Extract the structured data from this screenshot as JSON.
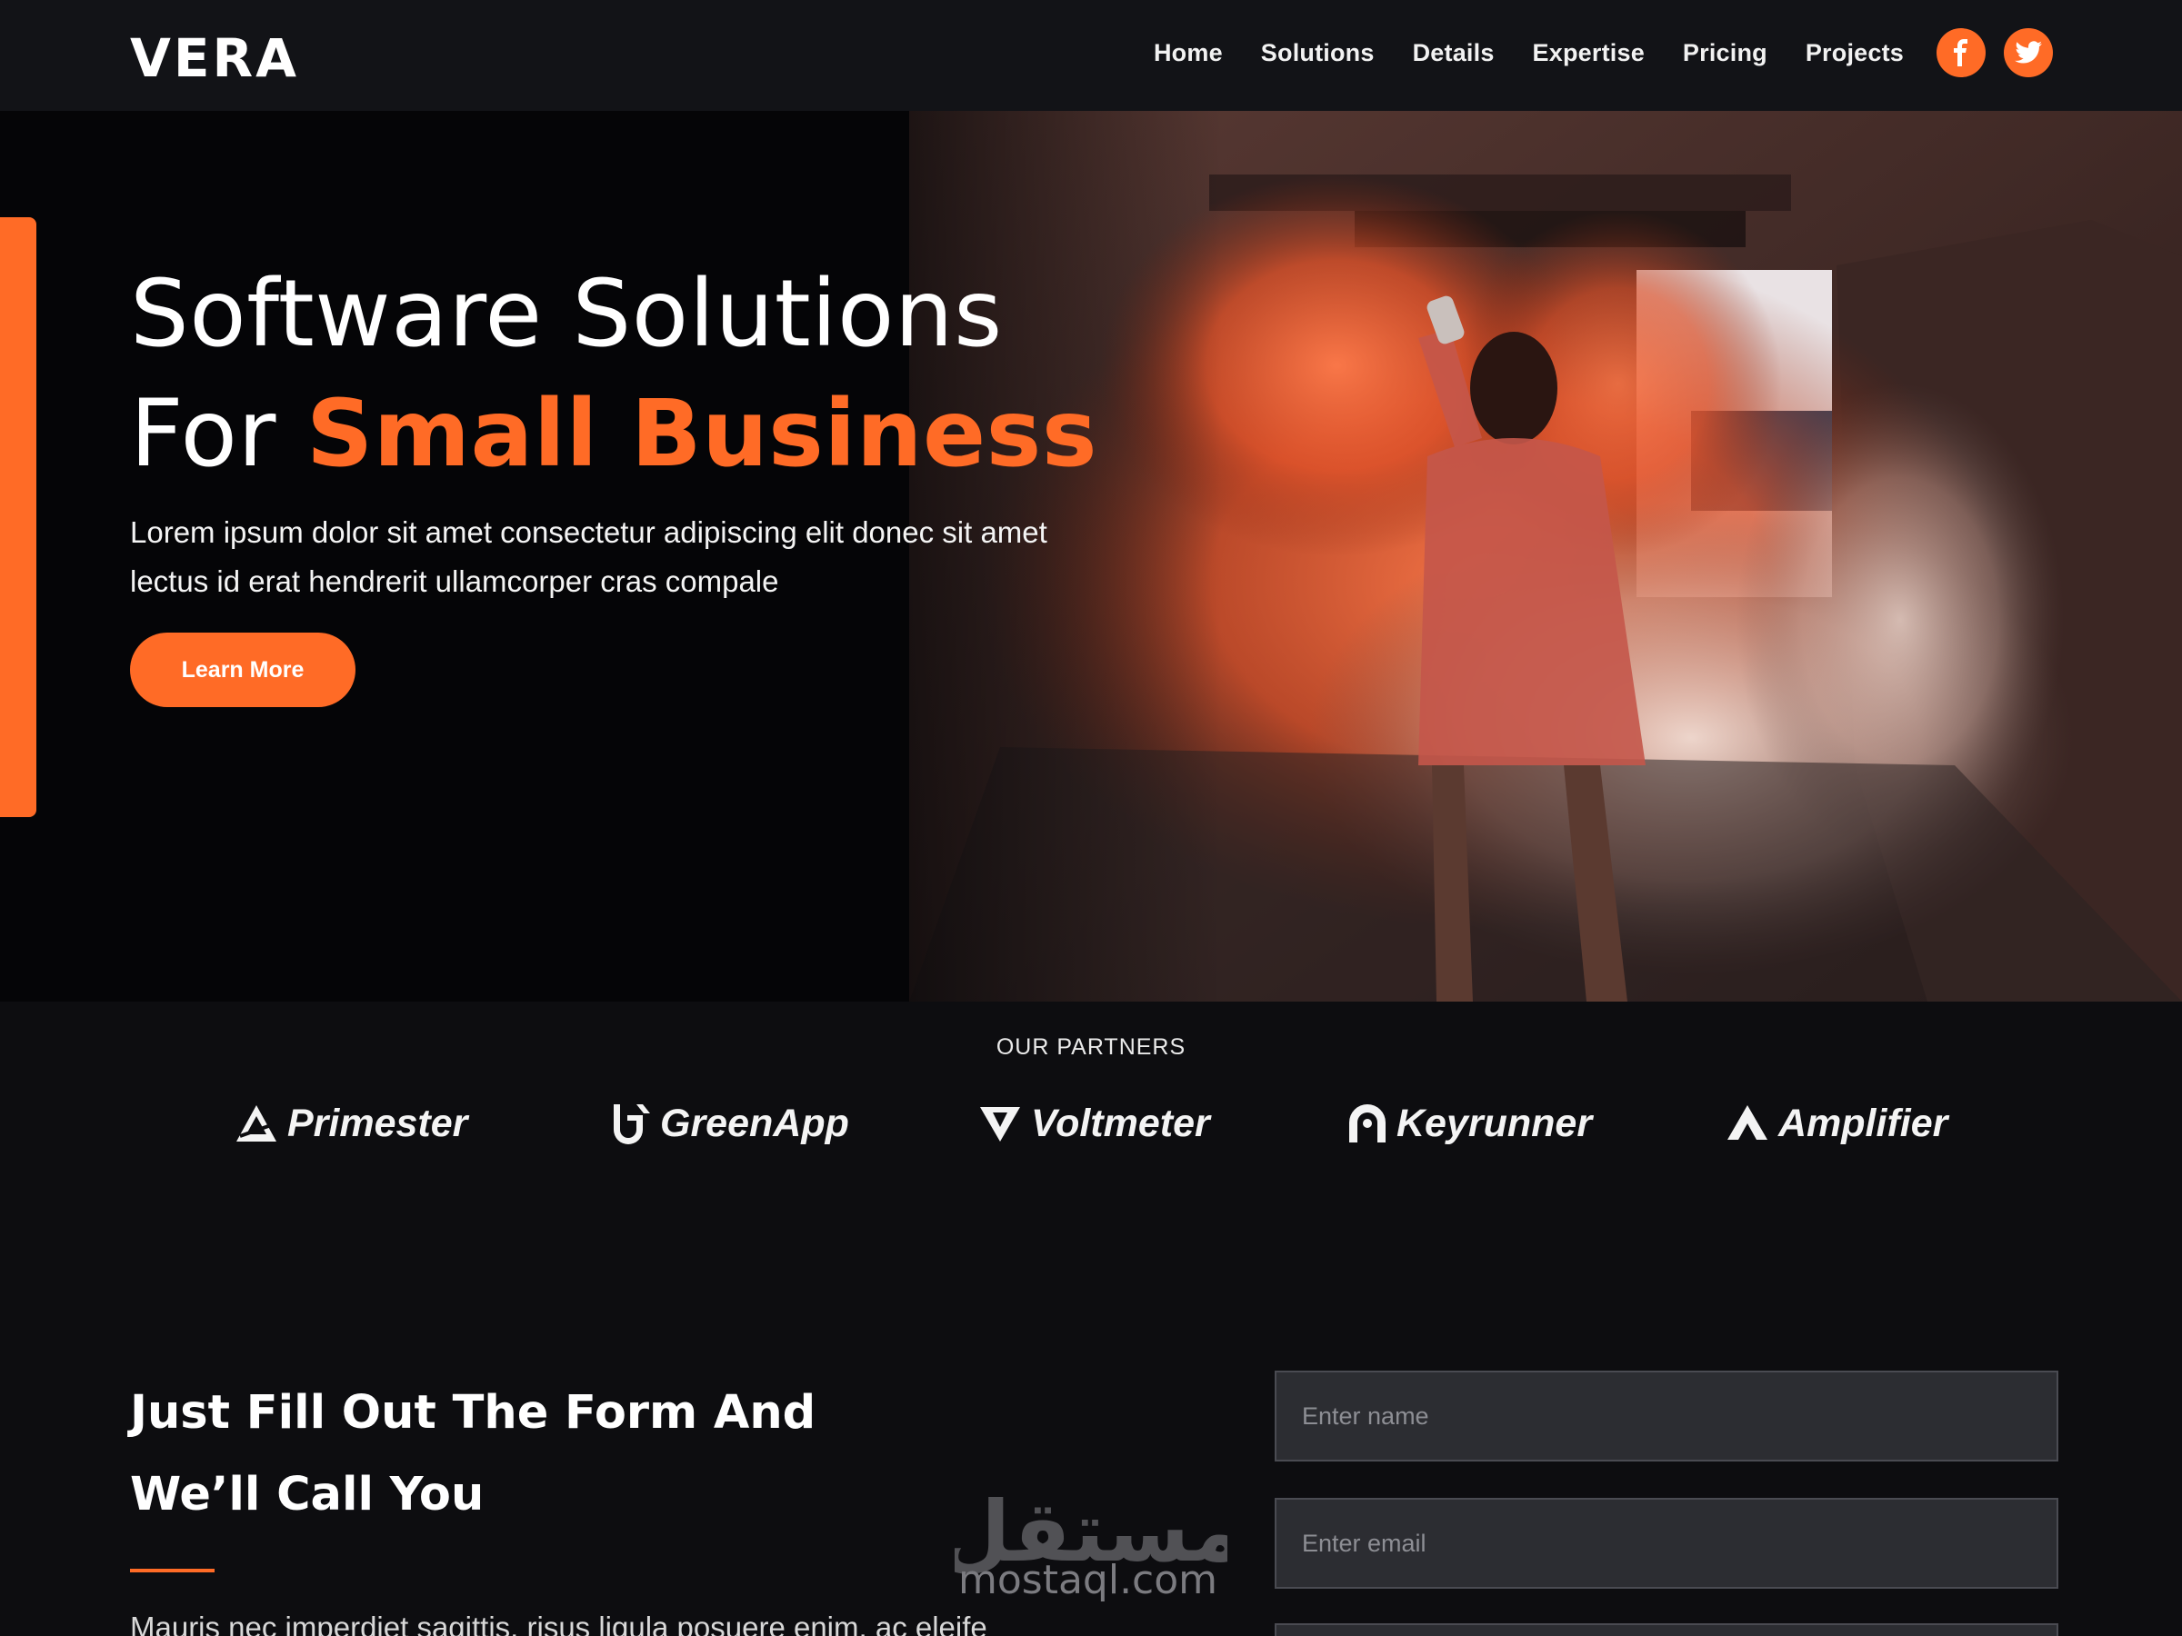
{
  "brand": {
    "logo": "VERA",
    "accent_color": "#ff6b26"
  },
  "nav": {
    "items": [
      "Home",
      "Solutions",
      "Details",
      "Expertise",
      "Pricing",
      "Projects"
    ],
    "socials": [
      {
        "icon": "facebook-icon"
      },
      {
        "icon": "twitter-icon"
      }
    ]
  },
  "hero": {
    "title_line1": "Software Solutions",
    "title_line2_prefix": "For ",
    "title_line2_accent": "Small Business",
    "description": "Lorem ipsum dolor sit amet consectetur adipiscing elit donec sit amet lectus id erat hendrerit ullamcorper cras compale",
    "button_label": "Learn More"
  },
  "partners": {
    "title": "OUR PARTNERS",
    "items": [
      {
        "name": "Primester",
        "icon": "primester-logo-icon"
      },
      {
        "name": "GreenApp",
        "icon": "greenapp-logo-icon"
      },
      {
        "name": "Voltmeter",
        "icon": "voltmeter-logo-icon"
      },
      {
        "name": "Keyrunner",
        "icon": "keyrunner-logo-icon"
      },
      {
        "name": "Amplifier",
        "icon": "amplifier-logo-icon"
      }
    ]
  },
  "form_section": {
    "heading_line1": "Just Fill Out The Form And",
    "heading_line2": "We’ll Call You",
    "description": "Mauris nec imperdiet sagittis, risus ligula posuere enim, ac eleife",
    "name_placeholder": "Enter name",
    "email_placeholder": "Enter email"
  },
  "watermark": {
    "arabic": "مستقل",
    "latin": "mostaql.com"
  }
}
